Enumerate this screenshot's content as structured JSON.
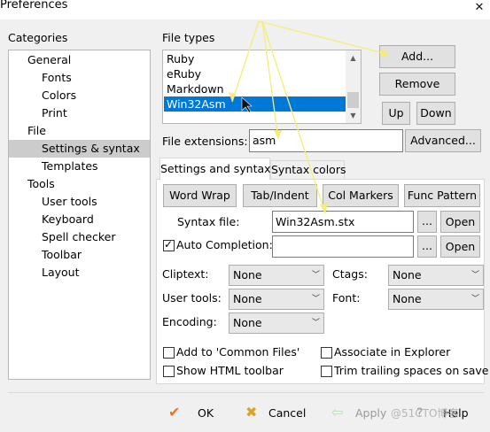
{
  "window": {
    "title": "Preferences",
    "close_icon": "close-icon"
  },
  "categories": {
    "heading": "Categories",
    "items": [
      {
        "label": "General",
        "level": 0
      },
      {
        "label": "Fonts",
        "level": 1
      },
      {
        "label": "Colors",
        "level": 1
      },
      {
        "label": "Print",
        "level": 1
      },
      {
        "label": "File",
        "level": 0
      },
      {
        "label": "Settings & syntax",
        "level": 1,
        "selected": true
      },
      {
        "label": "Templates",
        "level": 1
      },
      {
        "label": "Tools",
        "level": 0
      },
      {
        "label": "User tools",
        "level": 1
      },
      {
        "label": "Keyboard",
        "level": 1
      },
      {
        "label": "Spell checker",
        "level": 1
      },
      {
        "label": "Toolbar",
        "level": 1
      },
      {
        "label": "Layout",
        "level": 1
      }
    ]
  },
  "file_types": {
    "heading": "File types",
    "items": [
      "Ruby",
      "eRuby",
      "Markdown",
      "Win32Asm"
    ],
    "selected": "Win32Asm",
    "buttons": {
      "add": "Add...",
      "remove": "Remove",
      "up": "Up",
      "down": "Down"
    }
  },
  "extensions": {
    "label": "File extensions:",
    "value": "asm",
    "advanced_button": "Advanced..."
  },
  "tabs": {
    "settings": "Settings and syntax",
    "colors": "Syntax colors",
    "active": "settings"
  },
  "settings_tab": {
    "buttons": {
      "word_wrap": "Word Wrap",
      "tab_indent": "Tab/Indent",
      "col_markers": "Col Markers",
      "func_pattern": "Func Pattern"
    },
    "syntax_file": {
      "label": "Syntax file:",
      "value": "Win32Asm.stx",
      "browse": "...",
      "open": "Open"
    },
    "auto_completion": {
      "label": "Auto Completion:",
      "checked": true,
      "value": "",
      "browse": "...",
      "open": "Open"
    },
    "cliptext": {
      "label": "Cliptext:",
      "value": "None"
    },
    "ctags": {
      "label": "Ctags:",
      "value": "None"
    },
    "user_tools": {
      "label": "User tools:",
      "value": "None"
    },
    "font": {
      "label": "Font:",
      "value": "None"
    },
    "encoding": {
      "label": "Encoding:",
      "value": "None"
    },
    "checkboxes": {
      "add_common": {
        "label": "Add to 'Common Files'",
        "checked": false
      },
      "associate": {
        "label": "Associate in Explorer",
        "checked": false
      },
      "show_html": {
        "label": "Show HTML toolbar",
        "checked": false
      },
      "trim_trailing": {
        "label": "Trim trailing spaces on save",
        "checked": false
      }
    }
  },
  "footer": {
    "ok": "OK",
    "cancel": "Cancel",
    "apply": "Apply",
    "help": "Help",
    "watermark": "@51CTO博客"
  },
  "colors": {
    "selection": "#0078d7",
    "tree_selection": "#cccccc",
    "annotation": "#f5f07a",
    "ok_check": "#e8742a",
    "cancel_x": "#d9a22b"
  }
}
